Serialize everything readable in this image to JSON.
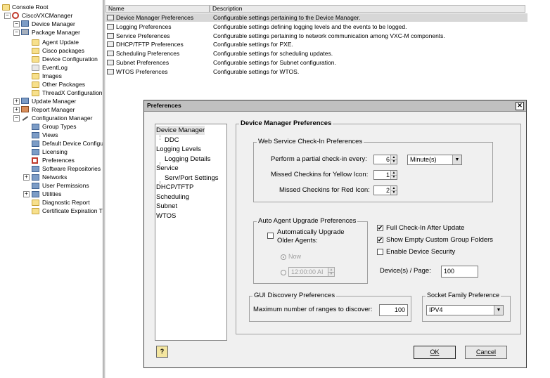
{
  "tree": {
    "root": "Console Root",
    "app": "CiscoVXCManager",
    "device_manager": "Device Manager",
    "package_manager": "Package Manager",
    "package_children": [
      "Agent Update",
      "Cisco packages",
      "Device Configuration",
      "EventLog",
      "Images",
      "Other Packages",
      "ThreadX Configuration"
    ],
    "update_manager": "Update Manager",
    "report_manager": "Report Manager",
    "configuration_manager": "Configuration Manager",
    "config_children": [
      "Group Types",
      "Views",
      "Default Device Configu",
      "Licensing",
      "Preferences",
      "Software Repositories",
      "Networks",
      "User Permissions",
      "Utilities",
      "Diagnostic Report",
      "Certificate Expiration Tr"
    ]
  },
  "list": {
    "columns": [
      "Name",
      "Description"
    ],
    "rows": [
      {
        "name": "Device Manager Preferences",
        "description": "Configurable settings pertaining to the Device Manager."
      },
      {
        "name": "Logging Preferences",
        "description": "Configurable settings defining logging levels and the events to be logged."
      },
      {
        "name": "Service Preferences",
        "description": "Configurable settings pertaining to network communication among VXC-M components."
      },
      {
        "name": "DHCP/TFTP Preferences",
        "description": "Configurable settings for PXE."
      },
      {
        "name": "Scheduling Preferences",
        "description": "Configurable settings for scheduling updates."
      },
      {
        "name": "Subnet Preferences",
        "description": "Configurable settings for Subnet configuration."
      },
      {
        "name": "WTOS Preferences",
        "description": "Configurable settings for WTOS."
      }
    ]
  },
  "dialog": {
    "title": "Preferences",
    "close": "✕",
    "nav": [
      "Device Manager",
      "DDC",
      "Logging Levels",
      "Logging Details",
      "Service",
      "Serv/Port Settings",
      "DHCP/TFTP",
      "Scheduling",
      "Subnet",
      "WTOS"
    ],
    "section_title": "Device Manager Preferences",
    "checkin": {
      "legend": "Web Service Check-In Preferences",
      "partial_label": "Perform a partial check-in every:",
      "partial_value": "6",
      "unit_value": "Minute(s)",
      "yellow_label": "Missed Checkins for Yellow Icon:",
      "yellow_value": "1",
      "red_label": "Missed Checkins for Red Icon:",
      "red_value": "2"
    },
    "upgrade": {
      "legend": "Auto Agent Upgrade Preferences",
      "auto_label_1": "Automatically Upgrade",
      "auto_label_2": "Older Agents:",
      "now_label": "Now",
      "time_value": "12:00:00 AI"
    },
    "options": {
      "full_checkin": "Full Check-In After Update",
      "show_empty": "Show Empty Custom Group Folders",
      "enable_security": "Enable Device Security",
      "check_mark": "✔"
    },
    "devices_page_label": "Device(s) / Page:",
    "devices_page_value": "100",
    "gui": {
      "legend": "GUI Discovery Preferences",
      "max_label": "Maximum number of ranges to discover:",
      "max_value": "100"
    },
    "socket": {
      "legend": "Socket Family Preference",
      "value": "IPV4"
    },
    "help": "?",
    "ok": "OK",
    "cancel": "Cancel"
  }
}
